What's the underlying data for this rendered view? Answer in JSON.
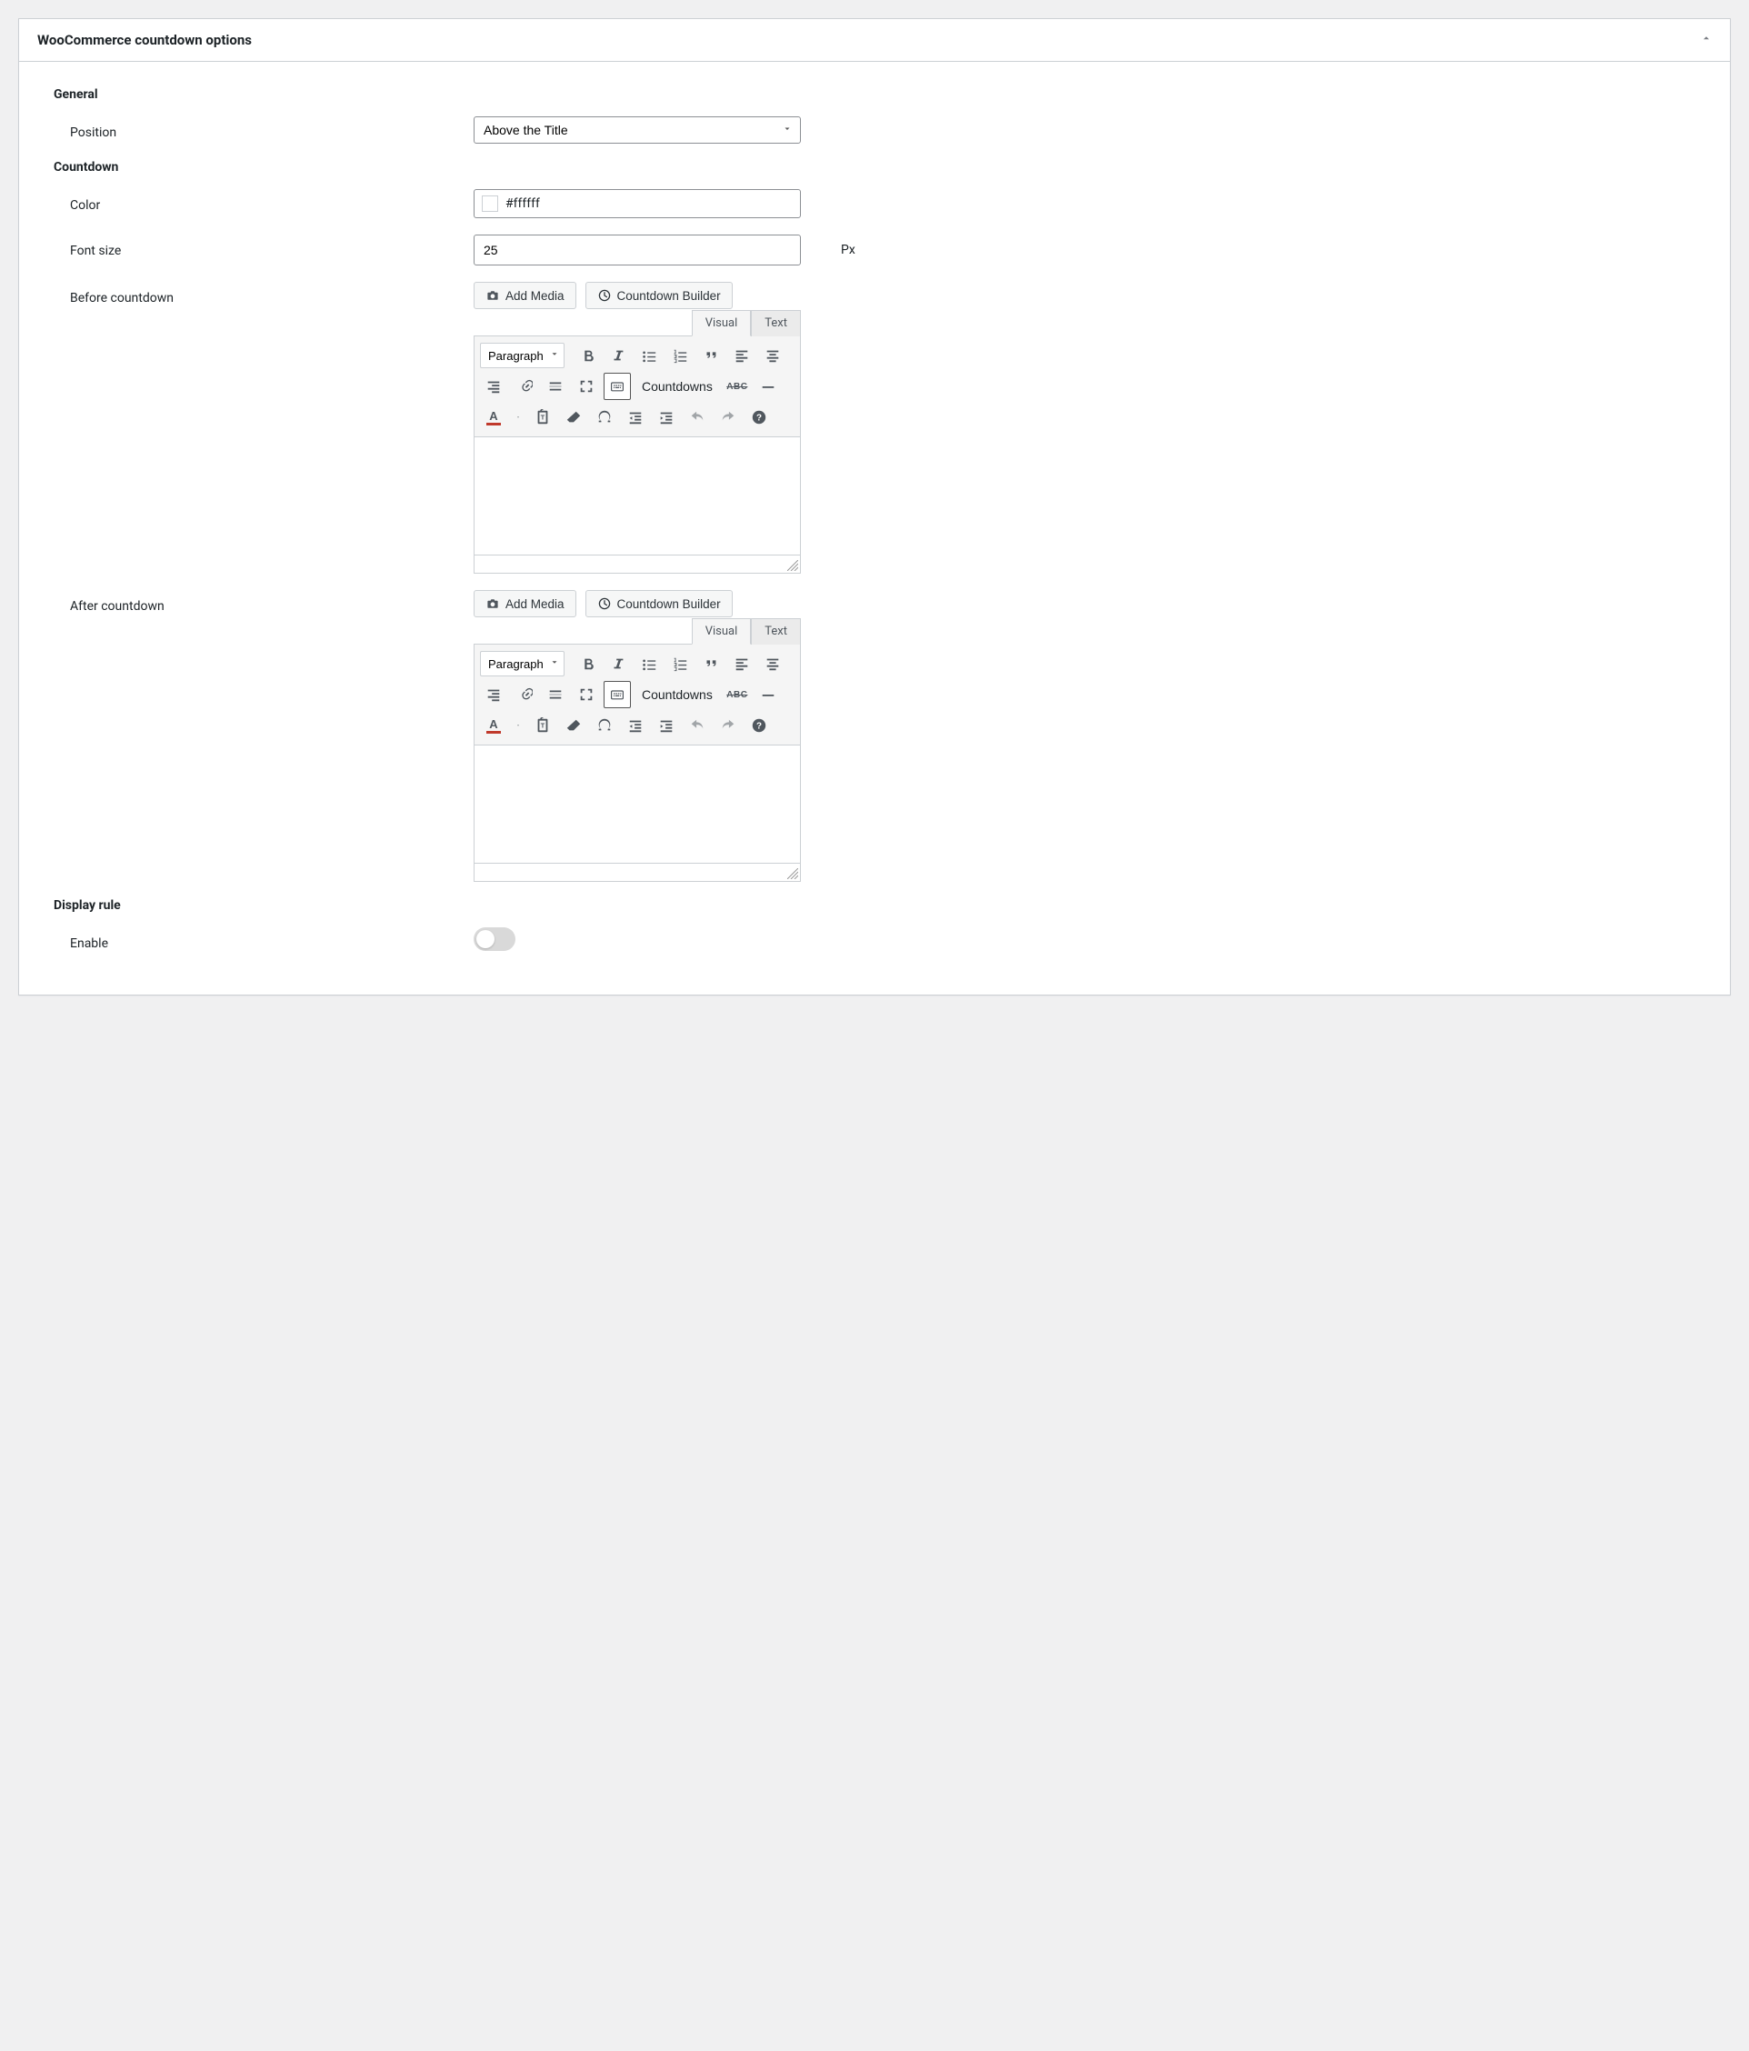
{
  "panel": {
    "title": "WooCommerce countdown options"
  },
  "sections": {
    "general": "General",
    "countdown": "Countdown",
    "display_rule": "Display rule"
  },
  "fields": {
    "position": {
      "label": "Position",
      "value": "Above the Title"
    },
    "color": {
      "label": "Color",
      "value": "#ffffff",
      "swatch": "#ffffff"
    },
    "font_size": {
      "label": "Font size",
      "value": "25",
      "unit": "Px"
    },
    "before_countdown": {
      "label": "Before countdown"
    },
    "after_countdown": {
      "label": "After countdown"
    },
    "enable": {
      "label": "Enable",
      "on": false
    }
  },
  "editor": {
    "add_media": "Add Media",
    "countdown_builder": "Countdown Builder",
    "tab_visual": "Visual",
    "tab_text": "Text",
    "paragraph": "Paragraph",
    "countdowns": "Countdowns"
  }
}
